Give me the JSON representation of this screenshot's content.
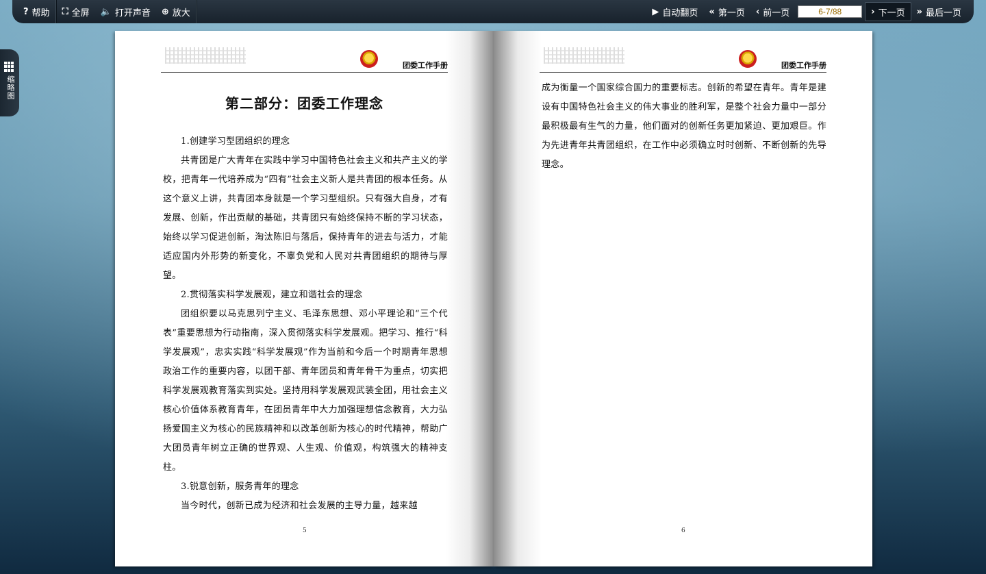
{
  "toolbar": {
    "help_label": "帮助",
    "fullscreen_label": "全屏",
    "sound_label": "打开声音",
    "zoom_label": "放大",
    "autoflip_label": "自动翻页",
    "first_label": "第一页",
    "prev_label": "前一页",
    "page_value": "6-7/88",
    "next_label": "下一页",
    "last_label": "最后一页"
  },
  "sidebar": {
    "tab_label": "缩略图"
  },
  "book": {
    "header_title": "团委工作手册",
    "left": {
      "heading": "第二部分：团委工作理念",
      "paragraphs": [
        "1.创建学习型团组织的理念",
        "共青团是广大青年在实践中学习中国特色社会主义和共产主义的学校，把青年一代培养成为“四有”社会主义新人是共青团的根本任务。从这个意义上讲，共青团本身就是一个学习型组织。只有强大自身，才有发展、创新，作出贡献的基础，共青团只有始终保持不断的学习状态，始终以学习促进创新，淘汰陈旧与落后，保持青年的进去与活力，才能适应国内外形势的新变化，不辜负党和人民对共青团组织的期待与厚望。",
        "2.贯彻落实科学发展观，建立和谐社会的理念",
        "团组织要以马克思列宁主义、毛泽东思想、邓小平理论和“三个代表”重要思想为行动指南，深入贯彻落实科学发展观。把学习、推行“科学发展观”，忠实实践“科学发展观”作为当前和今后一个时期青年思想政治工作的重要内容，以团干部、青年团员和青年骨干为重点，切实把科学发展观教育落实到实处。坚持用科学发展观武装全团，用社会主义核心价值体系教育青年，在团员青年中大力加强理想信念教育，大力弘扬爱国主义为核心的民族精神和以改革创新为核心的时代精神，帮助广大团员青年树立正确的世界观、人生观、价值观，构筑强大的精神支柱。",
        "3.锐意创新，服务青年的理念",
        "当今时代，创新已成为经济和社会发展的主导力量，越来越"
      ],
      "page_number": "5"
    },
    "right": {
      "paragraphs": [
        "成为衡量一个国家综合国力的重要标志。创新的希望在青年。青年是建设有中国特色社会主义的伟大事业的胜利军，是整个社会力量中一部分最积极最有生气的力量，他们面对的创新任务更加紧迫、更加艰巨。作为先进青年共青团组织，在工作中必须确立时时创新、不断创新的先导理念。"
      ],
      "page_number": "6"
    }
  },
  "icons": {
    "help": "?",
    "fullscreen": "⛶",
    "sound": "🔈",
    "zoom": "⊕",
    "autoflip": "▶",
    "first": "«",
    "prev": "‹",
    "next": "›",
    "last": "»"
  }
}
